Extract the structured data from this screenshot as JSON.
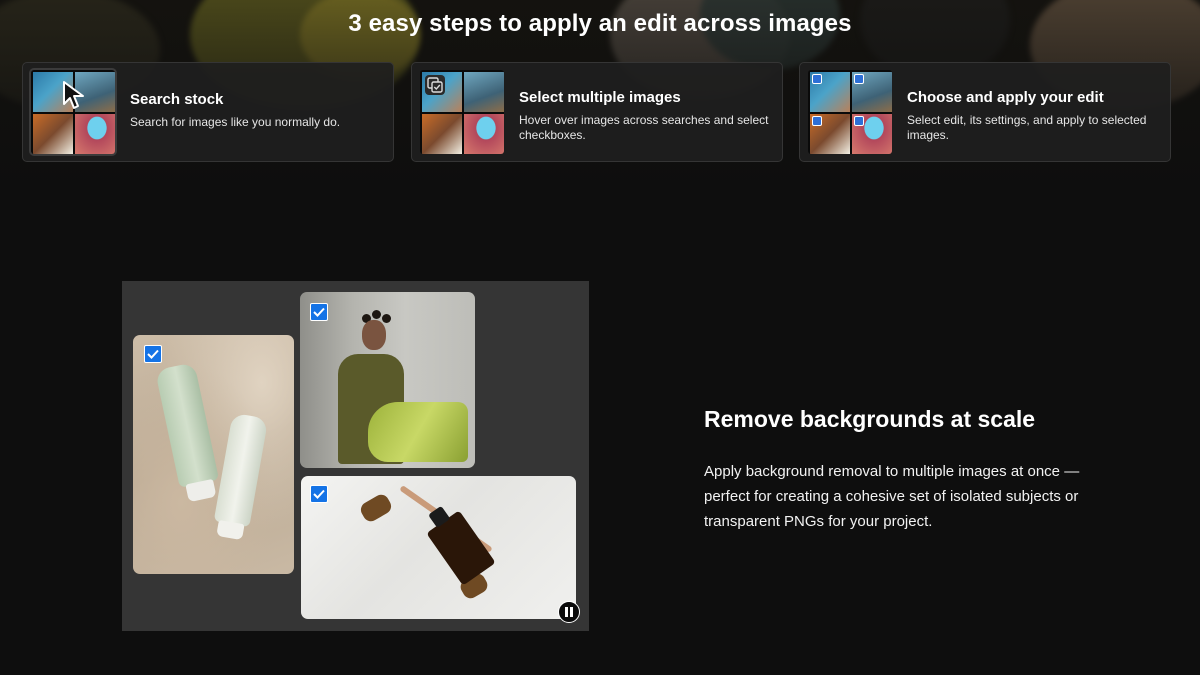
{
  "hero": {
    "headline": "3 easy steps to apply an edit across images"
  },
  "steps": [
    {
      "title": "Search stock",
      "description": "Search for images like you normally do."
    },
    {
      "title": "Select multiple images",
      "description": "Hover over images across searches and select checkboxes."
    },
    {
      "title": "Choose and apply your edit",
      "description": "Select edit, its settings, and apply to selected images."
    }
  ],
  "feature": {
    "title": "Remove backgrounds at scale",
    "body": "Apply background removal to multiple images at once — perfect for creating a cohesive set of isolated subjects or transparent PNGs for your project.",
    "video_state": "playing"
  },
  "colors": {
    "page_background": "#0e0e0e",
    "card_background": "#1e1e1e",
    "checkbox_accent": "#1473e6",
    "panel_background": "#353535"
  },
  "icons": {
    "cursor": "cursor-arrow-icon",
    "multi_select": "multi-select-icon",
    "checkbox": "checkbox-checked-icon",
    "pause": "pause-icon"
  }
}
